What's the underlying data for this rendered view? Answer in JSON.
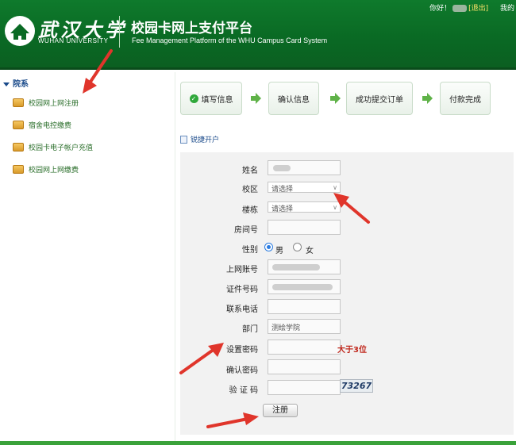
{
  "header": {
    "logo_cn": "武汉大学",
    "logo_en": "WUHAN UNIVERSITY",
    "title": "校园卡网上支付平台",
    "subtitle": "Fee Management Platform of the WHU Campus Card System",
    "greeting": "你好！",
    "logout": "[退出]",
    "my_link": "我的"
  },
  "sidebar": {
    "heading": "院系",
    "items": [
      {
        "label": "校园网上网注册"
      },
      {
        "label": "宿舍电控缴费"
      },
      {
        "label": "校园卡电子帐户充值"
      },
      {
        "label": "校园网上网缴费"
      }
    ]
  },
  "steps": [
    {
      "label": "填写信息"
    },
    {
      "label": "确认信息"
    },
    {
      "label": "成功提交订单"
    },
    {
      "label": "付款完成"
    }
  ],
  "section_link": "锐捷开户",
  "form": {
    "name_label": "姓名",
    "campus_label": "校区",
    "campus_value": "请选择",
    "building_label": "楼栋",
    "building_value": "请选择",
    "room_label": "房间号",
    "gender_label": "性别",
    "gender_male": "男",
    "gender_female": "女",
    "account_label": "上网账号",
    "id_label": "证件号码",
    "phone_label": "联系电话",
    "dept_label": "部门",
    "dept_value": "测绘学院",
    "password_label": "设置密码",
    "password_hint": "大于3位",
    "confirm_label": "确认密码",
    "captcha_label": "验 证 码",
    "captcha_value": "73267",
    "submit": "注册"
  },
  "colors": {
    "header_green": "#0a6a24",
    "panel_gray": "#f2f2f2",
    "hint_red": "#c0261b",
    "arrow_red": "#e0352b"
  }
}
